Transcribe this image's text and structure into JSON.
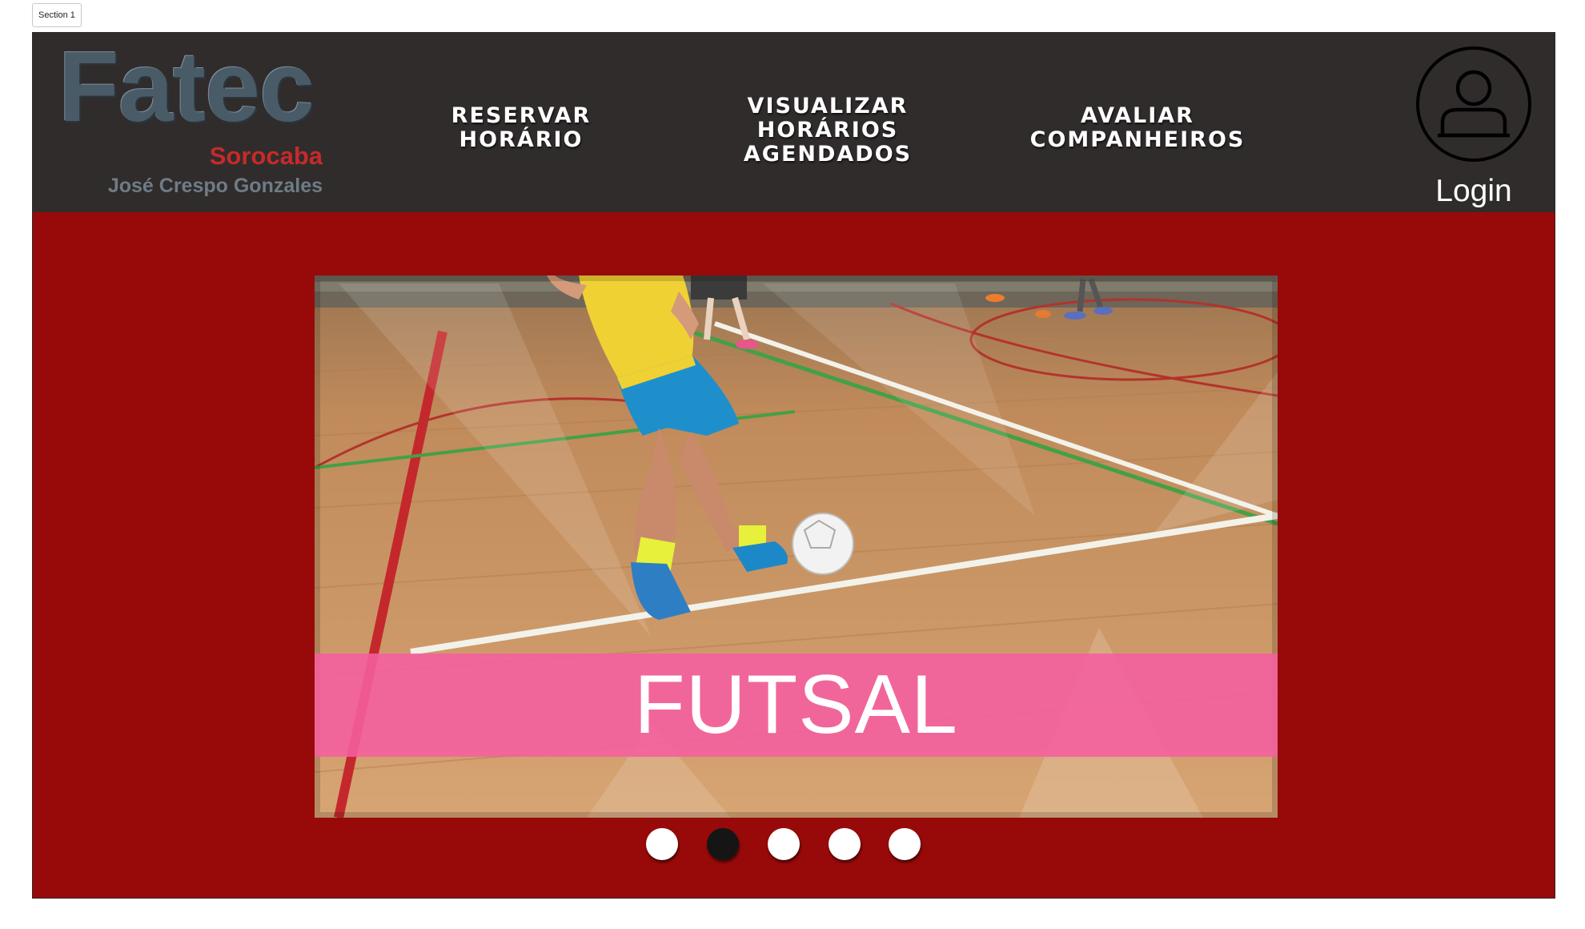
{
  "section_tag": "Section 1",
  "logo": {
    "name": "Fatec",
    "city": "Sorocaba",
    "person": "José Crespo Gonzales"
  },
  "nav": [
    {
      "label": "RESERVAR\nHORÁRIO"
    },
    {
      "label": "VISUALIZAR\nHORÁRIOS\nAGENDADOS"
    },
    {
      "label": "AVALIAR\nCOMPANHEIROS"
    }
  ],
  "login": {
    "label": "Login",
    "icon": "user-icon"
  },
  "carousel": {
    "caption": "FUTSAL",
    "slide_count": 5,
    "active_index": 1
  },
  "colors": {
    "header_bg": "#302c2c",
    "page_bg": "#980a0a",
    "banner": "#f55fa0",
    "logo_red": "#c52a2a",
    "logo_gray": "#4a5b68"
  }
}
